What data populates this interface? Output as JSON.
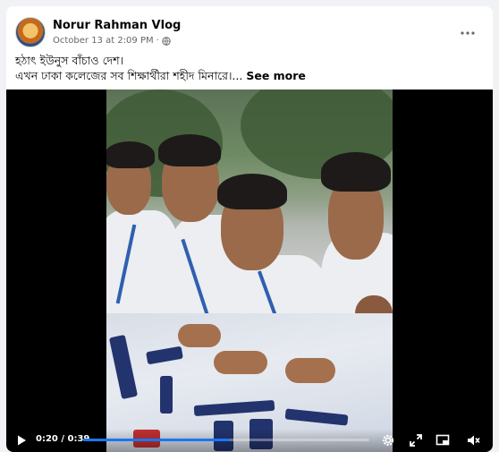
{
  "post": {
    "author": "Norur Rahman Vlog",
    "date": "October 13 at 2:09 PM",
    "separator": "·",
    "audience_icon": "globe-icon",
    "more_icon": "more-horizontal-icon",
    "text_line1": "হঠাৎ ইউনুস বাঁচাও দেশ।",
    "text_line2": "এখন ঢাকা কলেজের সব শিক্ষার্থীরা শহীদ মিনারে।...",
    "see_more": "See more"
  },
  "video": {
    "current_time": "0:20",
    "duration": "0:39",
    "time_display": "0:20 / 0:39",
    "progress": 0.513,
    "icons": [
      "play-icon",
      "settings-icon",
      "fullscreen-icon",
      "miniplayer-icon",
      "volume-icon"
    ]
  },
  "colors": {
    "accent": "#1877f2",
    "page_bg": "#f0f2f5",
    "card_bg": "#ffffff",
    "meta_text": "#65676b"
  }
}
